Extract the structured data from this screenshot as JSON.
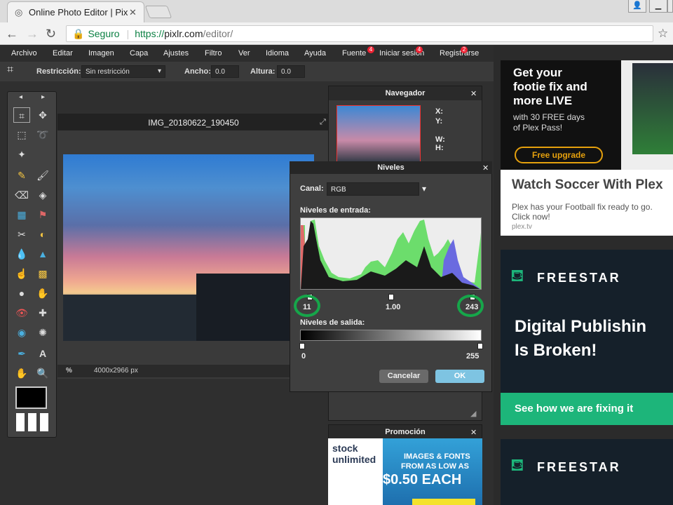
{
  "browser": {
    "tab_title": "Online Photo Editor | Pix",
    "url_secure": "Seguro",
    "url_scheme": "https://",
    "url_host": "pixlr.com",
    "url_path": "/editor/"
  },
  "menu": {
    "items": [
      "Archivo",
      "Editar",
      "Imagen",
      "Capa",
      "Ajustes",
      "Filtro",
      "Ver",
      "Idioma",
      "Ayuda",
      "Fuente",
      "Iniciar sesión",
      "Registrarse"
    ],
    "badges": [
      "4",
      "4",
      "2"
    ]
  },
  "options": {
    "restriction_label": "Restricción:",
    "restriction_value": "Sin restricción",
    "width_label": "Ancho:",
    "width_value": "0.0",
    "height_label": "Altura:",
    "height_value": "0.0"
  },
  "document": {
    "title": "IMG_20180622_190450",
    "zoom": "%",
    "size": "4000x2966 px"
  },
  "navigator": {
    "title": "Navegador",
    "x": "X:",
    "y": "Y:",
    "w": "W:",
    "h": "H:"
  },
  "levels": {
    "title": "Niveles",
    "channel_label": "Canal:",
    "channel_value": "RGB",
    "input_label": "Niveles de entrada:",
    "input_black": "11",
    "input_gamma": "1.00",
    "input_white": "243",
    "output_label": "Niveles de salida:",
    "output_black": "0",
    "output_white": "255",
    "cancel": "Cancelar",
    "ok": "OK"
  },
  "promo": {
    "title": "Promoción",
    "brand": "stock unlimited",
    "text1": "IMAGES & FONTS",
    "text2": "FROM AS LOW AS",
    "price": "$0.50 EACH"
  },
  "ad1": {
    "headline1": "Get your",
    "headline2": "footie fix and",
    "headline3": "more LIVE",
    "sub1": "with 30 FREE days",
    "sub2": "of Plex Pass!",
    "cta": "Free upgrade",
    "title": "Watch Soccer With Plex",
    "body1": "Plex has your Football fix ready to go.",
    "body2": "Click now!",
    "domain": "plex.tv"
  },
  "ad2": {
    "brand": "FREESTAR",
    "line1": "Digital Publishin",
    "line2": "Is Broken!",
    "cta": "See how we are fixing it"
  },
  "ad3": {
    "brand": "FREESTAR"
  },
  "colors": {
    "accent": "#7ec4e2",
    "ring": "#16a64a",
    "freestar_green": "#1db57a"
  }
}
